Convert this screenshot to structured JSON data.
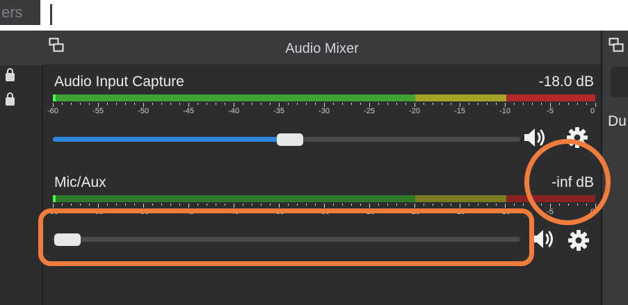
{
  "top": {
    "prev_tab_label": "ers"
  },
  "mixer": {
    "title": "Audio Mixer"
  },
  "right_pane": {
    "text": "Du"
  },
  "channels": [
    {
      "name": "Audio Input Capture",
      "level": "-18.0 dB",
      "volume_fraction": 0.42
    },
    {
      "name": "Mic/Aux",
      "level": "-inf dB",
      "volume_fraction": 0.03
    }
  ],
  "meter_scale": [
    "-60",
    "-55",
    "-50",
    "-45",
    "-40",
    "-35",
    "-30",
    "-25",
    "-20",
    "-15",
    "-10",
    "-5",
    "0"
  ],
  "icons": {
    "speaker": "speaker-icon",
    "gear": "gear-icon",
    "dock": "dock-float-icon",
    "lock": "lock-icon"
  },
  "colors": {
    "meter_green": "#3ea234",
    "meter_yellow": "#a6a329",
    "meter_red": "#b5292a",
    "slider_fill": "#2e86de",
    "annotation": "#f07d3c"
  }
}
